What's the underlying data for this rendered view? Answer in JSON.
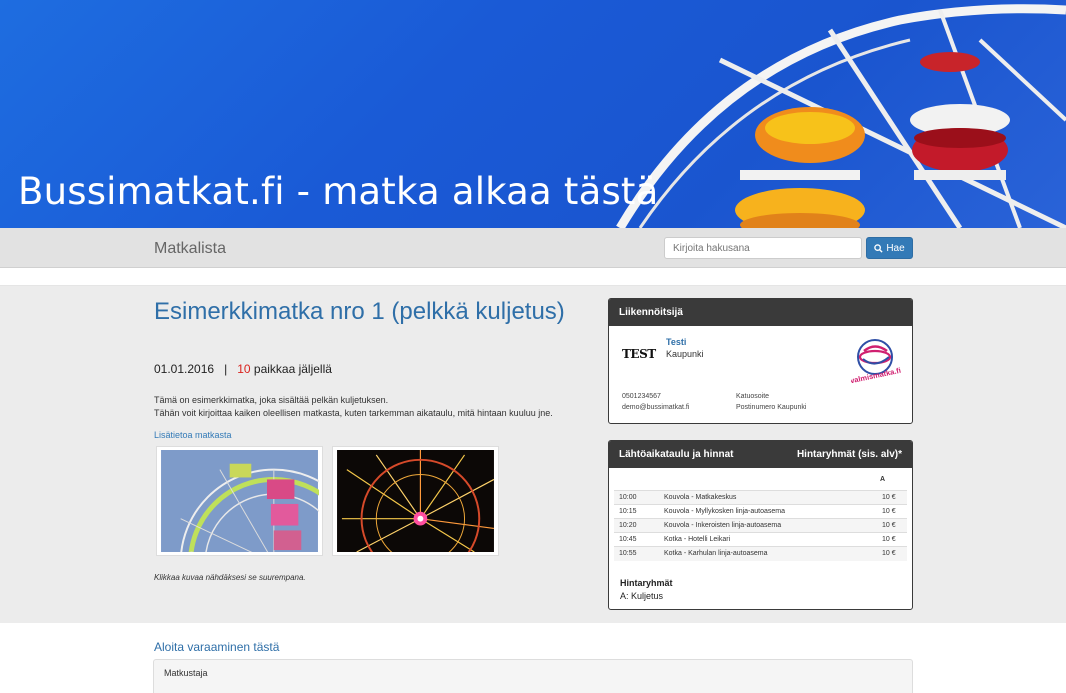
{
  "hero": {
    "title": "Bussimatkat.fi - matka alkaa tästä"
  },
  "navbar": {
    "brand": "Matkalista",
    "search_placeholder": "Kirjoita hakusana",
    "search_button": "Hae"
  },
  "trip": {
    "title": "Esimerkkimatka nro 1 (pelkkä kuljetus)",
    "date": "01.01.2016",
    "separator": "|",
    "seats_count": "10",
    "seats_label": "paikkaa jäljellä",
    "description_line1": "Tämä on esimerkkimatka, joka sisältää pelkän kuljetuksen.",
    "description_line2": "Tähän voit kirjoittaa kaiken oleellisen matkasta, kuten tarkemman aikataulu, mitä hintaan kuuluu jne.",
    "more_info_link": "Lisätietoa matkasta",
    "image_hint": "Klikkaa kuvaa nähdäksesi se suurempana."
  },
  "operator": {
    "heading": "Liikennöitsijä",
    "logo_text": "TEST",
    "name": "Testi",
    "city": "Kaupunki",
    "badge_text": "valmismatka.fi",
    "phone": "0501234567",
    "email": "demo@bussimatkat.fi",
    "address": "Katuosoite",
    "postal": "Postinumero Kaupunki"
  },
  "schedule": {
    "heading": "Lähtöaikataulu ja hinnat",
    "price_groups_heading": "Hintaryhmät (sis. alv)*",
    "column_a": "A",
    "rows": [
      {
        "time": "10:00",
        "stop": "Kouvola - Matkakeskus",
        "price": "10 €"
      },
      {
        "time": "10:15",
        "stop": "Kouvola - Myllykosken linja-autoasema",
        "price": "10 €"
      },
      {
        "time": "10:20",
        "stop": "Kouvola - Inkeroisten linja-autoasema",
        "price": "10 €"
      },
      {
        "time": "10:45",
        "stop": "Kotka - Hotelli Leikari",
        "price": "10 €"
      },
      {
        "time": "10:55",
        "stop": "Kotka - Karhulan linja-autoasema",
        "price": "10 €"
      }
    ],
    "groups_title": "Hintaryhmät",
    "groups_item": "A: Kuljetus"
  },
  "booking": {
    "title": "Aloita varaaminen tästä",
    "travellers_label": "Matkustaja"
  },
  "colors": {
    "link": "#337ab7",
    "title": "#2f6fa8",
    "seats": "#d9231e",
    "panel_header": "#3a3a3a"
  }
}
